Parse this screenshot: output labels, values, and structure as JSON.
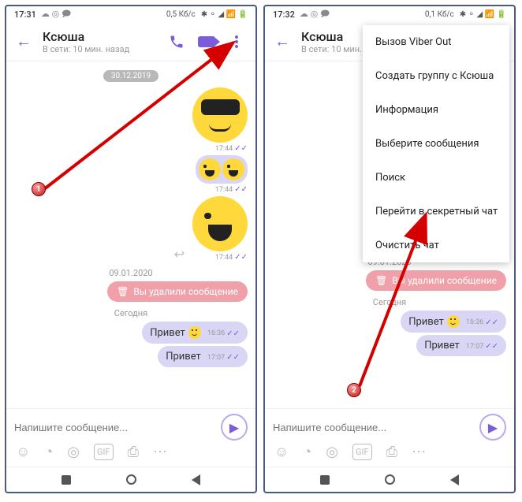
{
  "status": {
    "time1": "17:31",
    "time2": "17:32",
    "net1": "0,5 Кб/с",
    "net2": "0,1 Кб/с"
  },
  "header": {
    "name": "Ксюша",
    "subtitle": "В сети: 10 мин. назад"
  },
  "chat": {
    "date1": "30.12.2019",
    "t1": "17:44",
    "t2": "17:44",
    "t3": "17:44",
    "date2": "09.01.2020",
    "deleted": "Вы удалили сообщение",
    "today": "Сегодня",
    "msg1": "Привет",
    "msg1_time": "16:36",
    "msg2": "Привет",
    "msg2_time": "17:07"
  },
  "input": {
    "placeholder": "Напишите сообщение..."
  },
  "menu": {
    "items": [
      "Вызов Viber Out",
      "Создать группу с Ксюша",
      "Информация",
      "Выберите сообщения",
      "Поиск",
      "Перейти в секретный чат",
      "Очистить чат"
    ]
  },
  "badges": {
    "one": "1",
    "two": "2"
  }
}
